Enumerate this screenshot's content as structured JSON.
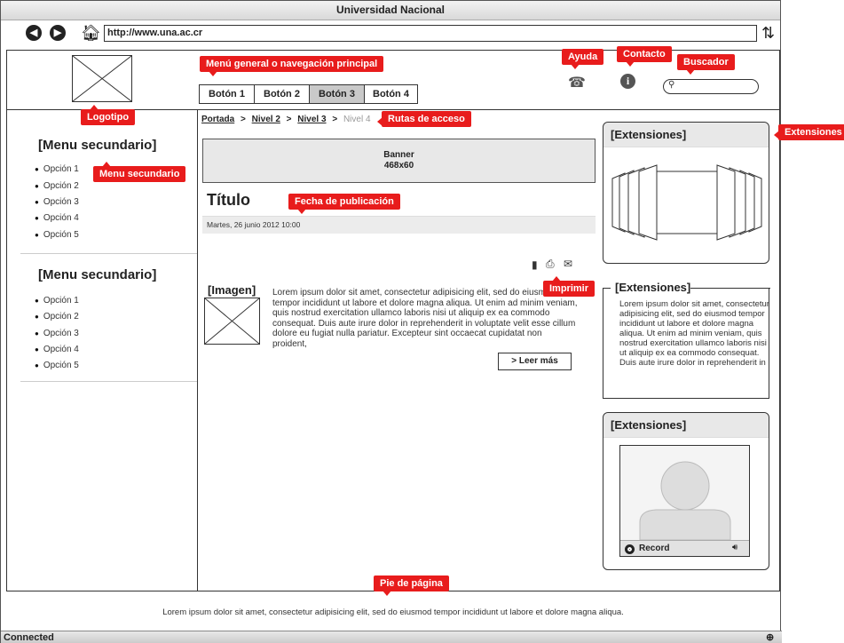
{
  "browser": {
    "title": "Universidad Nacional",
    "url": "http://www.una.ac.cr",
    "status": "Connected"
  },
  "header": {
    "nav_buttons": [
      "Botón 1",
      "Botón 2",
      "Botón 3",
      "Botón 4"
    ],
    "active_button": "Botón 3"
  },
  "breadcrumb": {
    "items": [
      "Portada",
      "Nivel 2",
      "Nivel 3"
    ],
    "current": "Nivel 4",
    "separator": ">"
  },
  "sidebar": {
    "sections": [
      {
        "title": "[Menu secundario]",
        "options": [
          "Opción 1",
          "Opción 2",
          "Opción 3",
          "Opción 4",
          "Opción 5"
        ]
      },
      {
        "title": "[Menu secundario]",
        "options": [
          "Opción 1",
          "Opción 2",
          "Opción 3",
          "Opción 4",
          "Opción 5"
        ]
      }
    ]
  },
  "main": {
    "banner_line1": "Banner",
    "banner_line2": "468x60",
    "title": "Título",
    "date": "Martes, 26 junio 2012 10:00",
    "image_label": "[Imagen]",
    "article_text": "Lorem ipsum dolor sit amet, consectetur adipisicing elit, sed do eiusmod tempor incididunt ut labore et dolore magna aliqua. Ut enim ad minim veniam, quis nostrud exercitation ullamco laboris nisi ut aliquip ex ea commodo consequat. Duis aute irure dolor in reprehenderit in voluptate velit esse cillum dolore eu fugiat nulla pariatur. Excepteur sint occaecat cupidatat non proident,",
    "read_more": "> Leer más"
  },
  "extensions": {
    "panel1_title": "[Extensiones]",
    "panel2_title": "[Extensiones]",
    "panel2_text": "Lorem ipsum dolor sit amet, consectetur adipisicing elit, sed do eiusmod tempor incididunt ut labore et dolore magna aliqua. Ut enim ad minim veniam, quis nostrud exercitation ullamco laboris nisi ut aliquip ex ea commodo consequat. Duis aute irure dolor in reprehenderit in",
    "panel3_title": "[Extensiones]",
    "record_label": "Record"
  },
  "footer": {
    "text": "Lorem ipsum dolor sit amet, consectetur adipisicing elit, sed do eiusmod tempor incididunt ut labore et dolore magna aliqua."
  },
  "annotations": {
    "menu_general": "Menú general o navegación principal",
    "ayuda": "Ayuda",
    "contacto": "Contacto",
    "buscador": "Buscador",
    "logotipo": "Logotipo",
    "rutas": "Rutas de acceso",
    "menu_secundario": "Menu secundario",
    "fecha": "Fecha de publicación",
    "imprimir": "Imprimir",
    "extensiones": "Extensiones",
    "pie": "Pie de página"
  },
  "colors": {
    "annotation": "#e81c1c",
    "side_accent": "#8fb8f0"
  },
  "icons": [
    "back-icon",
    "forward-icon",
    "home-icon",
    "reload-icon",
    "phone-icon",
    "info-icon",
    "search-icon",
    "document-icon",
    "print-icon",
    "mail-icon",
    "record-icon",
    "speaker-icon",
    "globe-icon"
  ]
}
